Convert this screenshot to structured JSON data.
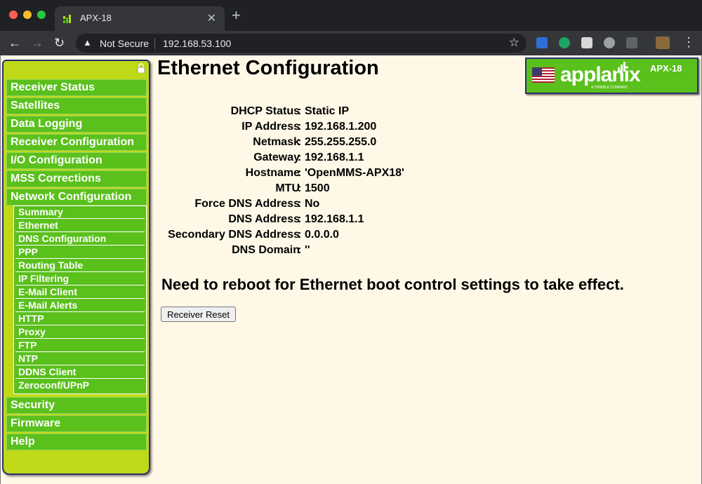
{
  "browser": {
    "tab_title": "APX-18",
    "tab_close": "✕",
    "new_tab": "+",
    "security_label": "Not Secure",
    "url": "192.168.53.100",
    "back": "←",
    "forward": "→",
    "reload": "↻",
    "star": "☆",
    "menu": "⋮",
    "warn": "▲"
  },
  "sidebar": {
    "items_top": [
      "Receiver Status",
      "Satellites",
      "Data Logging",
      "Receiver Configuration",
      "I/O Configuration",
      "MSS Corrections",
      "Network Configuration"
    ],
    "subitems": [
      "Summary",
      "Ethernet",
      "DNS Configuration",
      "PPP",
      "Routing Table",
      "IP Filtering",
      "E-Mail Client",
      "E-Mail Alerts",
      "HTTP",
      "Proxy",
      "FTP",
      "NTP",
      "DDNS Client",
      "Zeroconf/UPnP"
    ],
    "items_bottom": [
      "Security",
      "Firmware",
      "Help"
    ]
  },
  "header": {
    "title": "Ethernet Configuration",
    "brand": "applanix",
    "brand_sub": "A TRIMBLE COMPANY",
    "model": "APX-18"
  },
  "config": [
    {
      "label": "DHCP Status",
      "value": "Static IP"
    },
    {
      "label": "IP Address",
      "value": "192.168.1.200"
    },
    {
      "label": "Netmask",
      "value": "255.255.255.0"
    },
    {
      "label": "Gateway",
      "value": "192.168.1.1"
    },
    {
      "label": "Hostname",
      "value": "'OpenMMS-APX18'"
    },
    {
      "label": "MTU",
      "value": "1500"
    },
    {
      "label": "Force DNS Address",
      "value": "No"
    },
    {
      "label": "DNS Address",
      "value": "192.168.1.1"
    },
    {
      "label": "Secondary DNS Address",
      "value": "0.0.0.0"
    },
    {
      "label": "DNS Domain",
      "value": "''"
    }
  ],
  "colon": ":",
  "notice": "Need to reboot for Ethernet boot control settings to take effect.",
  "reset_button": "Receiver Reset",
  "colors": {
    "menu_green": "#5ac01c",
    "sidebar_bg": "#bfd918",
    "page_bg": "#fff8e7",
    "border_navy": "#2a2f6e"
  }
}
